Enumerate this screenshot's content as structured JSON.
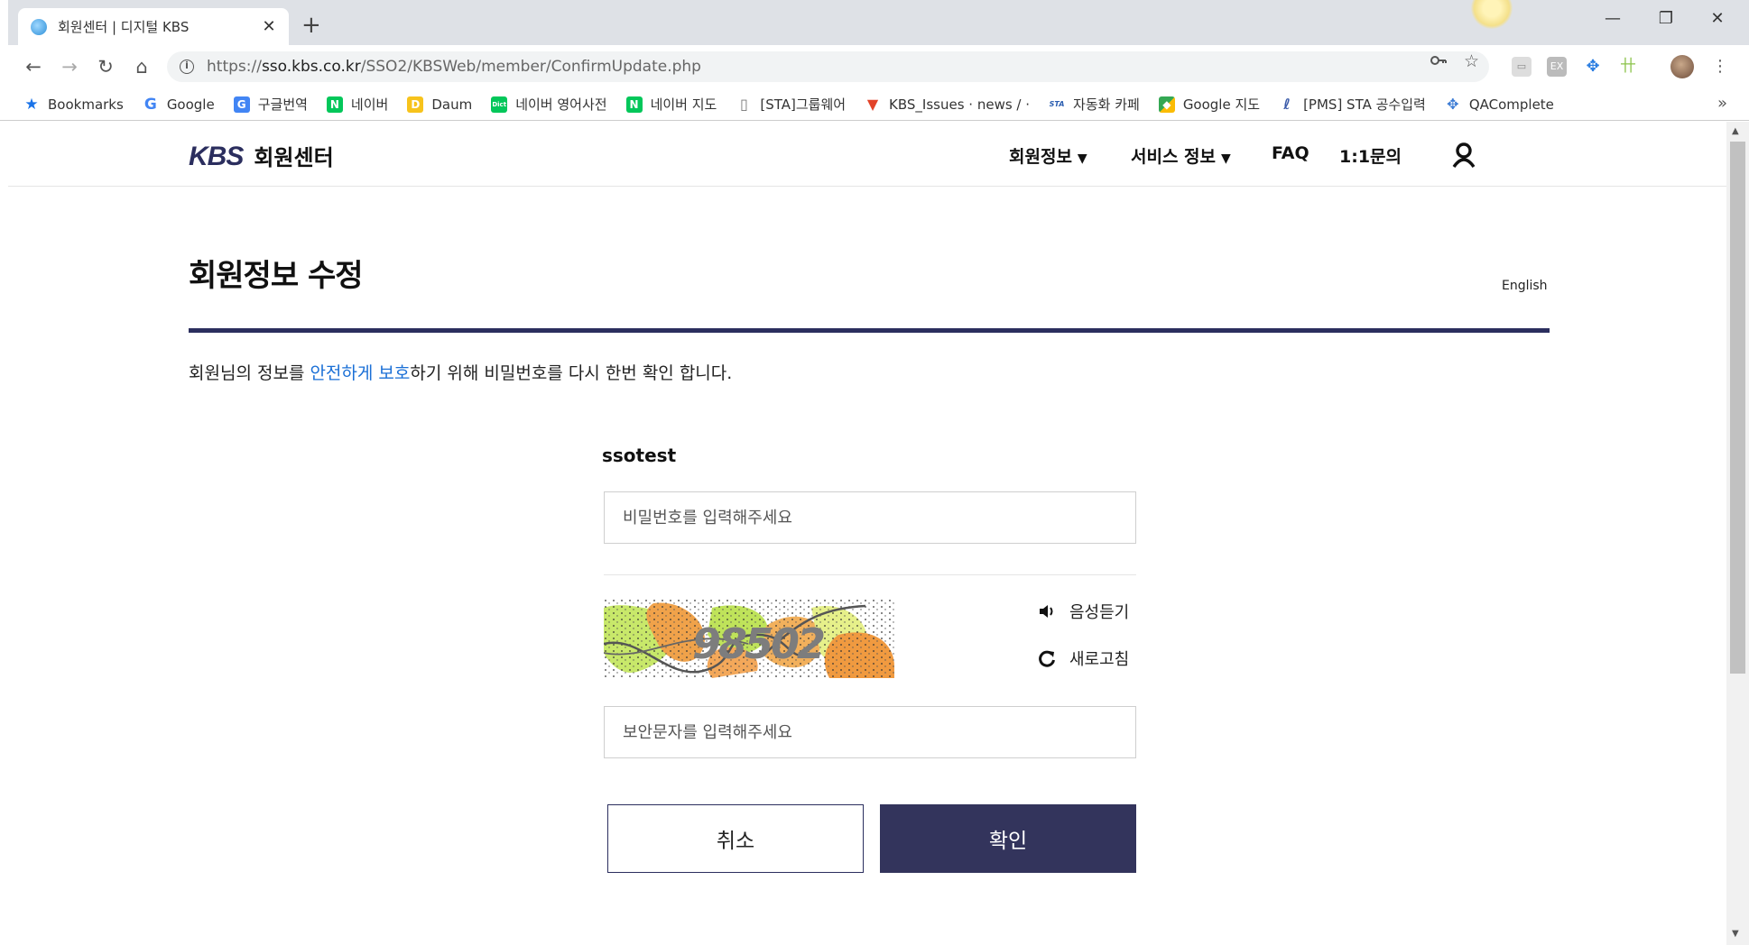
{
  "browser": {
    "tab_title": "회원센터 | 디지털 KBS",
    "tab_close": "✕",
    "new_tab": "+",
    "url_prefix": "https://",
    "url_host": "sso.kbs.co.kr",
    "url_path": "/SSO2/KBSWeb/member/ConfirmUpdate.php",
    "window_controls": {
      "minimize": "—",
      "restore": "❐",
      "close": "✕"
    },
    "bookmarks": [
      {
        "label": "Bookmarks",
        "icon": "star-icon",
        "color": "#1a73e8"
      },
      {
        "label": "Google",
        "icon": "google-icon",
        "color": "#4285f4"
      },
      {
        "label": "구글번역",
        "icon": "translate-icon",
        "color": "#4285f4"
      },
      {
        "label": "네이버",
        "icon": "naver-icon",
        "color": "#03c75a"
      },
      {
        "label": "Daum",
        "icon": "daum-icon",
        "color": "#f7c31c"
      },
      {
        "label": "네이버 영어사전",
        "icon": "naver-dict-icon",
        "color": "#03c75a"
      },
      {
        "label": "네이버 지도",
        "icon": "naver-icon",
        "color": "#03c75a"
      },
      {
        "label": "[STA]그룹웨어",
        "icon": "page-icon",
        "color": "#888888"
      },
      {
        "label": "KBS_Issues · news / ·",
        "icon": "gitlab-icon",
        "color": "#e24329"
      },
      {
        "label": "자동화 카페",
        "icon": "sta-icon",
        "color": "#2a5db0"
      },
      {
        "label": "Google 지도",
        "icon": "maps-icon",
        "color": "#34a853"
      },
      {
        "label": "[PMS] STA 공수입력",
        "icon": "pms-icon",
        "color": "#3b5ba9"
      },
      {
        "label": "QAComplete",
        "icon": "qacomplete-icon",
        "color": "#3b7bd4"
      }
    ],
    "bookmarks_more": "»"
  },
  "site": {
    "logo_kbs": "KBS",
    "logo_name": "회원센터",
    "nav": [
      {
        "label": "회원정보",
        "has_menu": true
      },
      {
        "label": "서비스 정보",
        "has_menu": true
      },
      {
        "label": "FAQ",
        "has_menu": false
      },
      {
        "label": "1:1문의",
        "has_menu": false
      }
    ],
    "dropdown_arrow": "▼"
  },
  "main": {
    "title": "회원정보 수정",
    "language_link": "English",
    "desc_before": "회원님의 정보를 ",
    "desc_highlight": "안전하게 보호",
    "desc_after": "하기 위해 비밀번호를 다시 한번 확인 합니다.",
    "user_id": "ssotest",
    "password_placeholder": "비밀번호를 입력해주세요",
    "captcha_text": "98502",
    "audio_label": "음성듣기",
    "refresh_label": "새로고침",
    "captcha_placeholder": "보안문자를 입력해주세요",
    "cancel_label": "취소",
    "confirm_label": "확인"
  },
  "colors": {
    "brand_navy": "#2b2e5e",
    "button_navy": "#33345c",
    "highlight_blue": "#1a6fd6"
  }
}
